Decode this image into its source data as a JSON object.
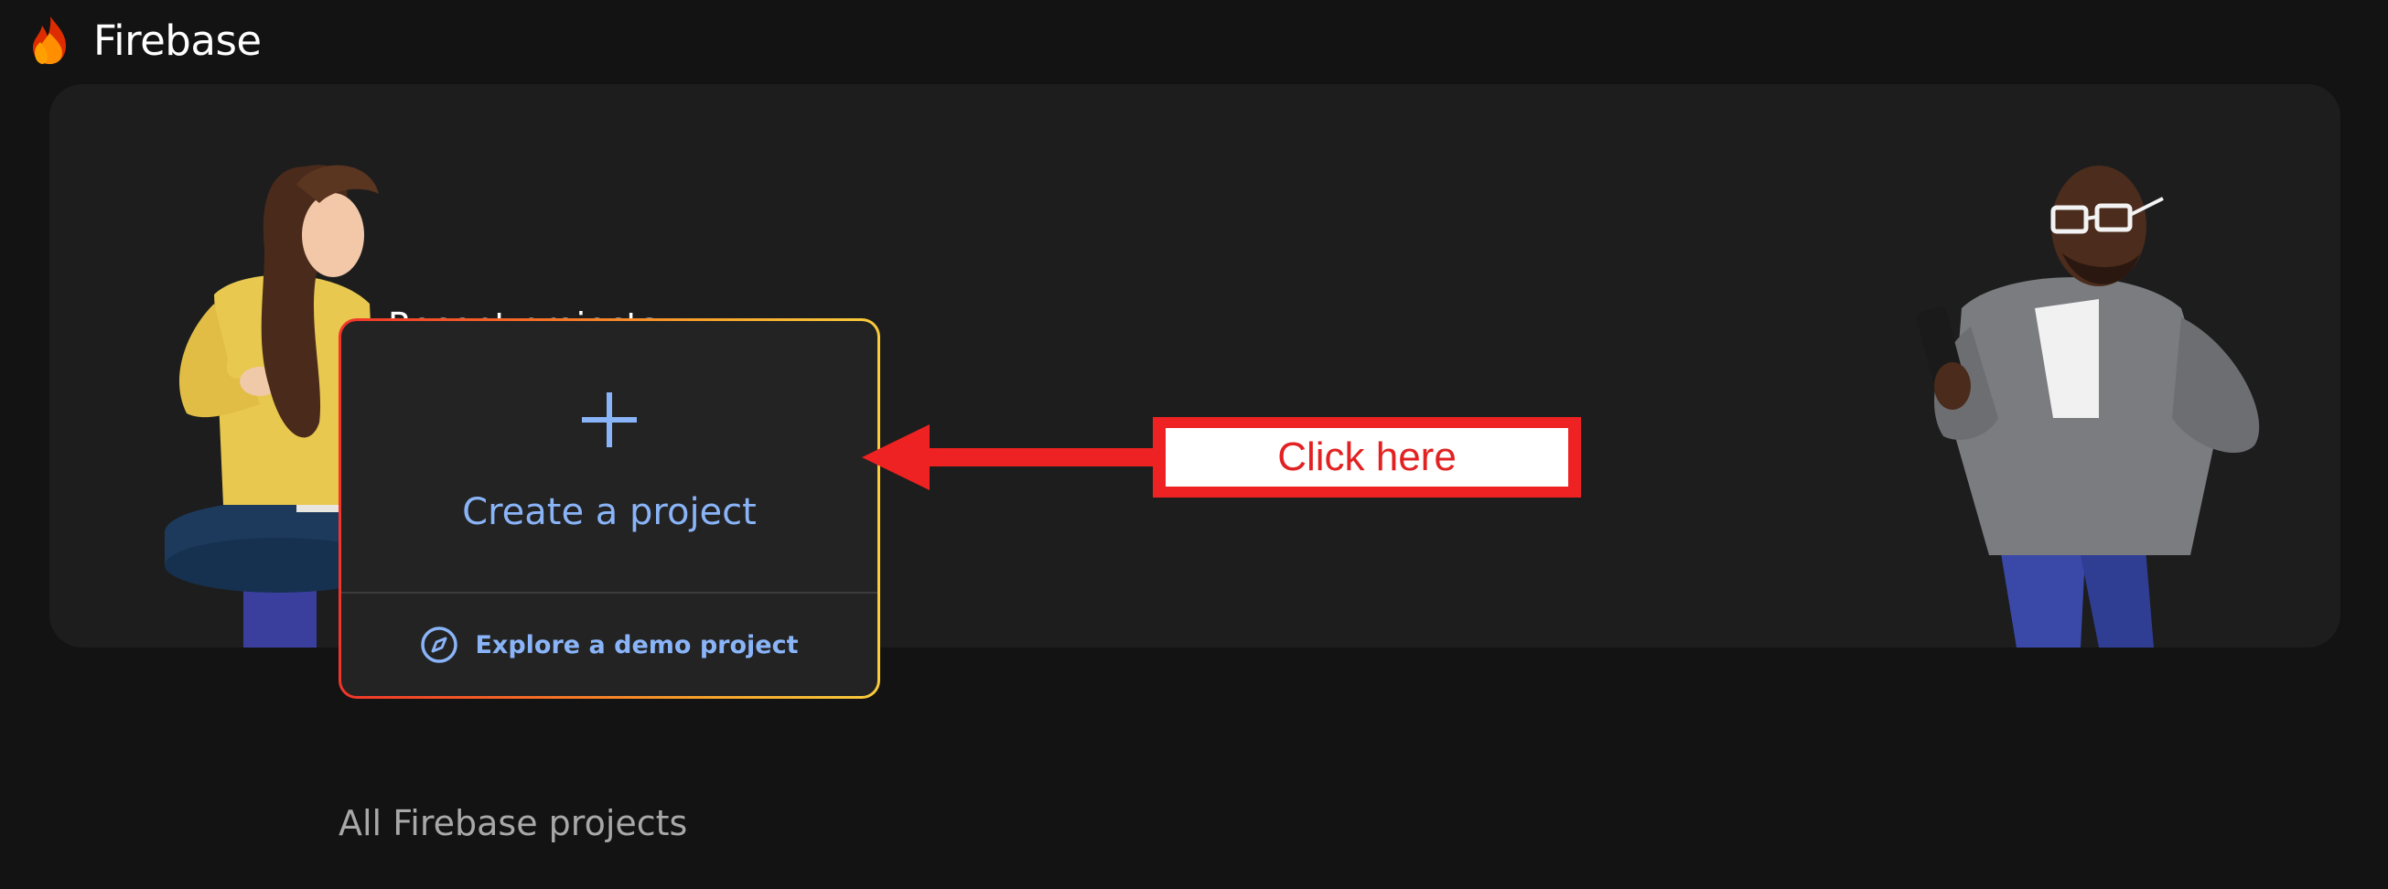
{
  "app": {
    "name": "Firebase"
  },
  "banner": {
    "recent_title": "Recent projects"
  },
  "card": {
    "create_label": "Create a project",
    "demo_label": "Explore a demo project",
    "create_icon": "plus-icon",
    "demo_icon": "compass-icon"
  },
  "annotation": {
    "label": "Click here",
    "color": "#ee2222"
  },
  "all_projects": {
    "title": "All Firebase projects"
  },
  "colors": {
    "background": "#131313",
    "panel": "#1d1d1d",
    "card": "#232323",
    "accent_link": "#8ab4f8"
  }
}
